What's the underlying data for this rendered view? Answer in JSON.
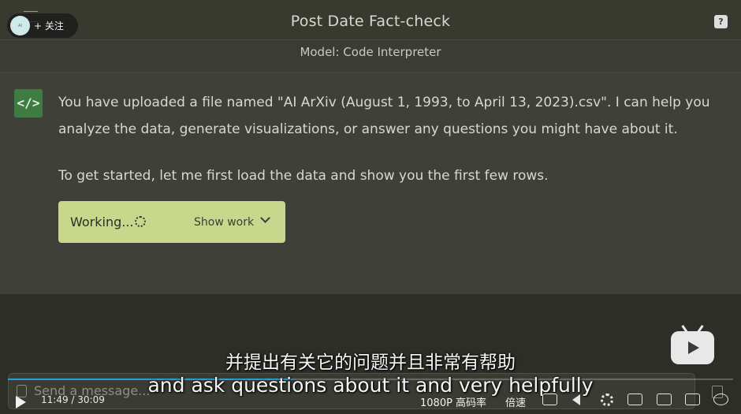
{
  "header": {
    "title": "Post Date Fact-check",
    "follow_label": "关注",
    "model_label": "Model: Code Interpreter"
  },
  "conversation": {
    "assistant_icon": "</>",
    "message_1": "You have uploaded a file named \"AI ArXiv (August 1, 1993, to April 13, 2023).csv\". I can help you analyze the data, generate visualizations, or answer any questions you might have about it.",
    "message_2": "To get started, let me first load the data and show you the first few rows.",
    "working_label": "Working...",
    "show_work_label": "Show work"
  },
  "composer": {
    "placeholder": "Send a message..."
  },
  "video": {
    "subtitle_zh": "并提出有关它的问题并且非常有帮助",
    "subtitle_en": "and ask questions about it and very helpfully",
    "time": "11:49 / 30:09",
    "quality": "1080P 高码率",
    "speed": "倍速",
    "progress": 0.392
  },
  "colors": {
    "accent_green": "#3f7c44",
    "working_bg": "#c7d88c",
    "progress": "#2a9fd8"
  },
  "icons": [
    "menu-icon",
    "help-icon",
    "code-icon",
    "spinner-icon",
    "chevron-down-icon",
    "attach-icon",
    "send-icon",
    "play-icon",
    "subtitle-off-icon",
    "volume-icon",
    "gear-icon",
    "pip-icon",
    "widescreen-icon",
    "fullscreen-icon",
    "bilibili-tv-icon"
  ]
}
